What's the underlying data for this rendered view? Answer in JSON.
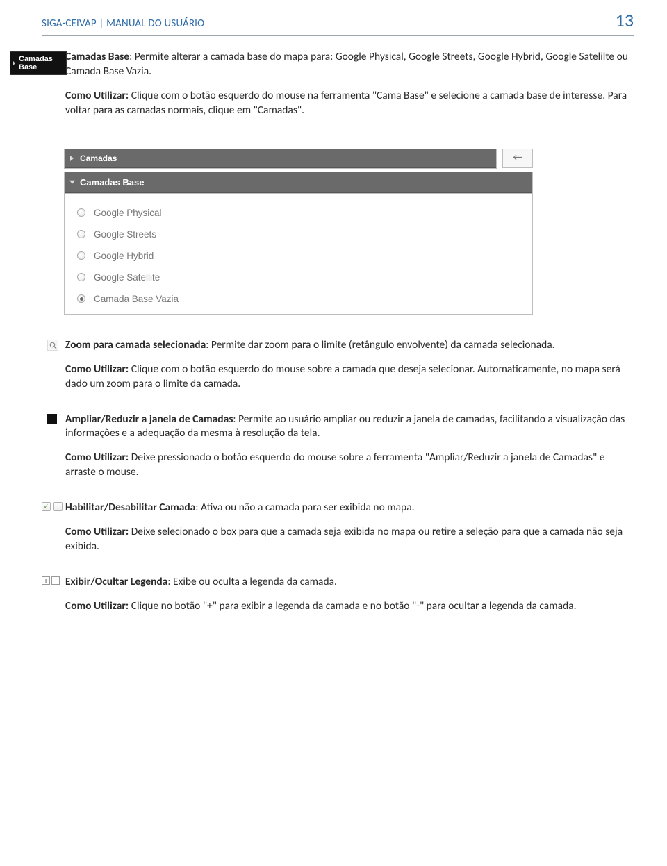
{
  "header": {
    "title": "SIGA-CEIVAP | MANUAL DO USUÁRIO",
    "page_number": "13"
  },
  "icons": {
    "camadas_base_btn": "Camadas Base",
    "collapse_arrow": "←"
  },
  "sec1": {
    "title": "Camadas Base",
    "desc": ": Permite alterar a camada base do mapa para: Google Physical, Google Streets, Google Hybrid, Google Satelilte ou Camada Base Vazia.",
    "howto_label": "Como Utilizar:",
    "howto_text": " Clique com o botão esquerdo do mouse na ferramenta \"Cama Base\" e selecione a camada base de interesse. Para voltar para as camadas normais, clique em \"Camadas\"."
  },
  "panel": {
    "header_camadas": "Camadas",
    "header_camadas_base": "Camadas Base",
    "options": [
      "Google Physical",
      "Google Streets",
      "Google Hybrid",
      "Google Satellite",
      "Camada Base Vazia"
    ],
    "selected_index": 4
  },
  "sec2": {
    "title": "Zoom para camada selecionada",
    "desc": ": Permite dar zoom para o limite (retângulo envolvente) da camada selecionada.",
    "howto_label": "Como Utilizar:",
    "howto_text": " Clique com o botão esquerdo do mouse sobre a camada que deseja selecionar. Automaticamente, no mapa será dado um zoom para o limite da camada."
  },
  "sec3": {
    "title": "Ampliar/Reduzir a janela de Camadas",
    "desc": ": Permite ao usuário ampliar ou reduzir a janela de camadas, facilitando a visualização das informações e a adequação da mesma à resolução da tela.",
    "howto_label": "Como Utilizar:",
    "howto_text": " Deixe pressionado o botão esquerdo do mouse sobre a ferramenta \"Ampliar/Reduzir a janela de Camadas\" e arraste o mouse."
  },
  "sec4": {
    "title": "Habilitar/Desabilitar Camada",
    "desc": ": Ativa ou não a camada para ser exibida no mapa.",
    "howto_label": "Como Utilizar:",
    "howto_text": " Deixe selecionado o box para que a camada seja exibida no mapa ou retire a seleção para que a camada não seja exibida."
  },
  "sec5": {
    "title": "Exibir/Ocultar Legenda",
    "desc": ": Exibe ou oculta a legenda da camada.",
    "howto_label": "Como Utilizar:",
    "howto_text": " Clique no botão \"+\" para exibir a legenda da camada e no botão \"-\" para ocultar a legenda da camada."
  }
}
